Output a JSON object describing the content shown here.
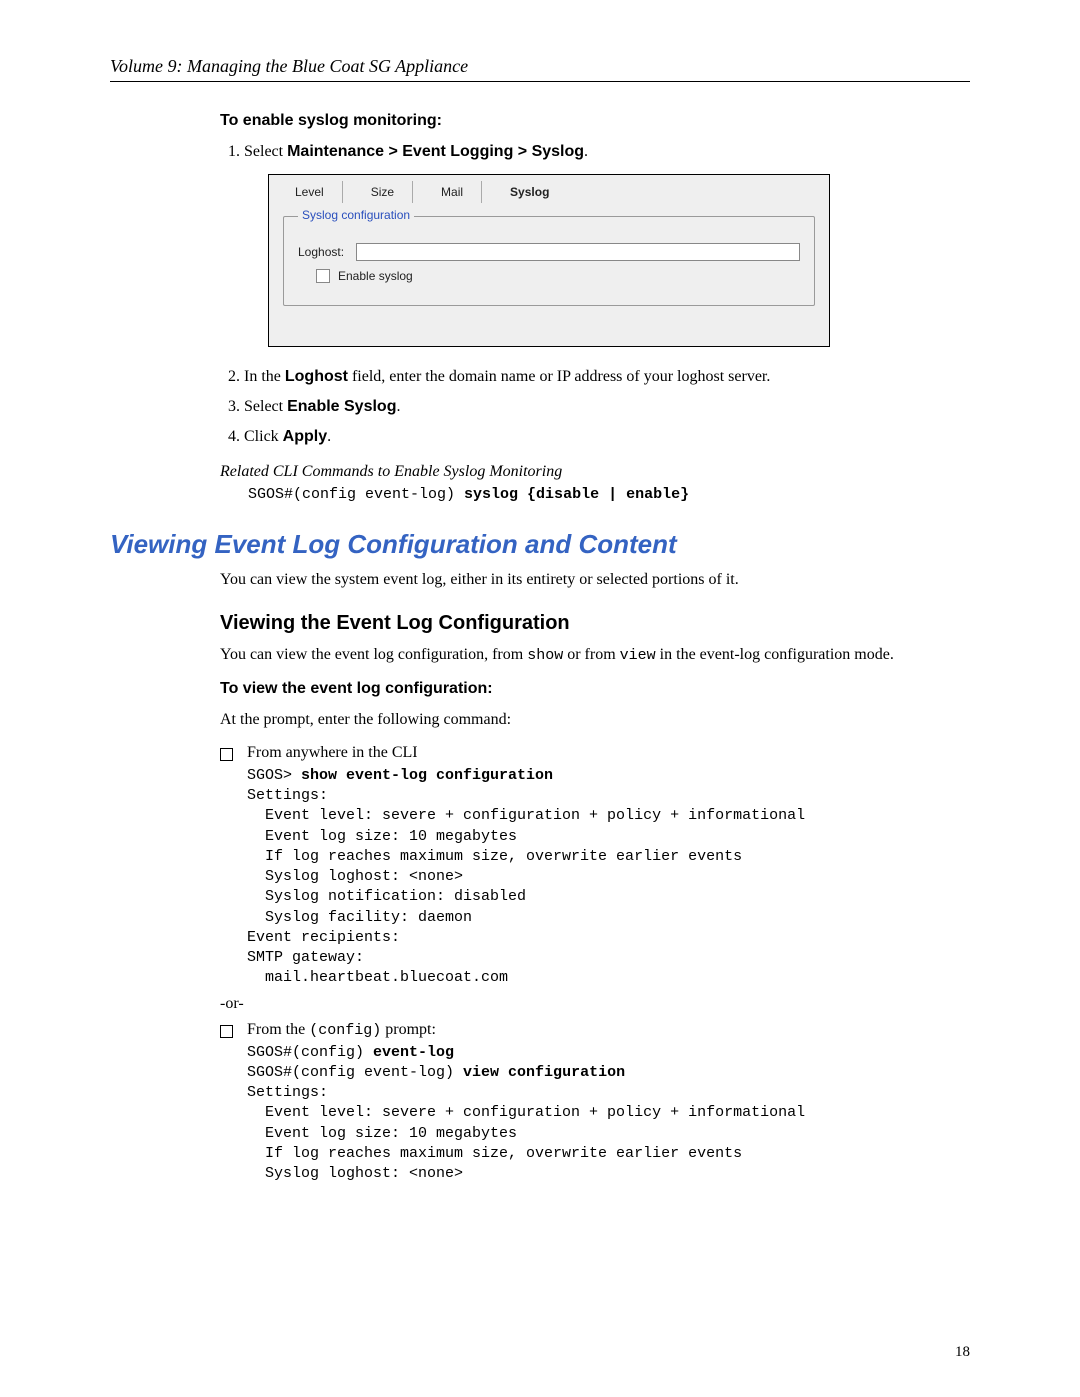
{
  "running_header": "Volume 9: Managing the Blue Coat SG Appliance",
  "page_number": "18",
  "syslog_enable": {
    "heading": "To enable syslog monitoring:",
    "steps": {
      "s1_prefix": "Select ",
      "s1_bold": "Maintenance > Event Logging > Syslog",
      "s1_suffix": ".",
      "s2_prefix": "In the ",
      "s2_bold": "Loghost",
      "s2_suffix": " field, enter the domain name or IP address of your loghost server.",
      "s3_prefix": "Select ",
      "s3_bold": "Enable Syslog",
      "s3_suffix": ".",
      "s4_prefix": "Click ",
      "s4_bold": "Apply",
      "s4_suffix": "."
    },
    "related_cli_heading": "Related CLI Commands to Enable Syslog Monitoring",
    "related_cli_line_plain": "SGOS#(config event-log) ",
    "related_cli_line_bold": "syslog {disable | enable}"
  },
  "ui_shot": {
    "tabs": {
      "level": "Level",
      "size": "Size",
      "mail": "Mail",
      "syslog": "Syslog"
    },
    "fieldset_legend": "Syslog configuration",
    "loghost_label": "Loghost:",
    "enable_checkbox_label": "Enable syslog"
  },
  "section2": {
    "title": "Viewing Event Log Configuration and Content",
    "intro": "You can view the system event log, either in its entirety or selected portions of it."
  },
  "section3": {
    "title": "Viewing the Event Log Configuration",
    "intro_a": "You can view the event log configuration, from ",
    "intro_m1": "show",
    "intro_b": " or from ",
    "intro_m2": "view",
    "intro_c": " in the event-log configuration mode.",
    "how_to": "To view the event log configuration:",
    "prompt_intro": "At the prompt, enter the following command:",
    "bullet1": "From anywhere in the CLI",
    "cli_block1_l1_p": "SGOS> ",
    "cli_block1_l1_b": "show event-log configuration",
    "cli_block1_rest": "Settings:\n  Event level: severe + configuration + policy + informational\n  Event log size: 10 megabytes\n  If log reaches maximum size, overwrite earlier events\n  Syslog loghost: <none>\n  Syslog notification: disabled\n  Syslog facility: daemon\nEvent recipients:\nSMTP gateway:\n  mail.heartbeat.bluecoat.com",
    "or": "-or-",
    "bullet2_a": "From the ",
    "bullet2_m": "(config)",
    "bullet2_b": " prompt:",
    "cli_block2_l1_p": "SGOS#(config) ",
    "cli_block2_l1_b": "event-log",
    "cli_block2_l2_p": "SGOS#(config event-log) ",
    "cli_block2_l2_b": "view configuration",
    "cli_block2_rest": "Settings:\n  Event level: severe + configuration + policy + informational\n  Event log size: 10 megabytes\n  If log reaches maximum size, overwrite earlier events\n  Syslog loghost: <none>"
  }
}
